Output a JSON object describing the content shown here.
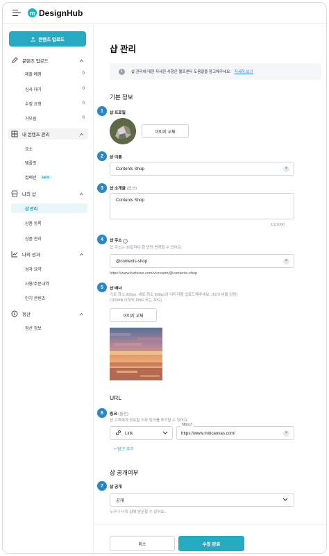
{
  "app": {
    "logo_letter": "m",
    "name": "DesignHub"
  },
  "sidebar": {
    "upload_button": "콘텐츠 업로드",
    "sections": [
      {
        "title": "콘텐츠 업로드",
        "icon": "pencil-icon",
        "items": [
          {
            "label": "제출 예정",
            "count": "0"
          },
          {
            "label": "심사 대기",
            "count": "0"
          },
          {
            "label": "수정 요청",
            "count": "0"
          },
          {
            "label": "거부됨",
            "count": "0"
          }
        ]
      },
      {
        "title": "내 콘텐츠 관리",
        "icon": "grid-icon",
        "items": [
          {
            "label": "요소"
          },
          {
            "label": "템플릿"
          },
          {
            "label": "컬렉션",
            "badge": "NEW"
          }
        ]
      },
      {
        "title": "나의 샵",
        "icon": "shop-icon",
        "items": [
          {
            "label": "샵 관리"
          },
          {
            "label": "상품 등록"
          },
          {
            "label": "상품 관리"
          }
        ]
      },
      {
        "title": "나의 성과",
        "icon": "chart-icon",
        "items": [
          {
            "label": "성과 요약"
          },
          {
            "label": "사용/주문내역"
          },
          {
            "label": "인기 콘텐츠"
          }
        ]
      },
      {
        "title": "정산",
        "icon": "dollar-icon",
        "items": [
          {
            "label": "정산 정보"
          }
        ]
      }
    ]
  },
  "main": {
    "title": "샵 관리",
    "info_text": "샵 관리에 대한 자세한 사항은 헬프센터 도움말을 참고해주세요.",
    "info_link": "자세히 보기",
    "basic_info_title": "기본 정보",
    "profile": {
      "step": "1",
      "label": "샵 프로필",
      "button": "이미지 교체"
    },
    "name": {
      "step": "2",
      "label": "샵 이름",
      "value": "Contents Shop"
    },
    "intro": {
      "step": "3",
      "label": "샵 소개글",
      "optional": "(옵션)",
      "value": "Contents Shop",
      "counter": "13/1000"
    },
    "address": {
      "step": "4",
      "label": "샵 주소",
      "hint": "샵 주소는 30일마다 한 번만 변경할 수 있어요.",
      "value": "@contents-shop",
      "url": "https://www.bizhows.com/v/creator/@contents-shop"
    },
    "banner": {
      "step": "5",
      "label": "샵 배너",
      "hint1": "가로 최소 800px, 세로 최소 800px의 이미지를 업로드해주세요. (16:9 비율 권장)",
      "hint2": "(100MB 이하의 PNG 또는 JPG)",
      "button": "이미지 교체"
    },
    "url_title": "URL",
    "link": {
      "step": "6",
      "label": "링크",
      "optional": "(옵션)",
      "hint": "샵 고객에게 공유할 외부 링크를 추가할 수 있어요.",
      "type": "Link",
      "float_label": "https://",
      "value": "https://www.miricanvas.com/",
      "add": "+ 링크 추가"
    },
    "public_title": "샵 공개여부",
    "public": {
      "step": "7",
      "label": "샵 공개",
      "value": "공개",
      "hint": "누구나 나의 샵에 방문할 수 있어요."
    },
    "cancel": "취소",
    "save": "수정 완료"
  }
}
